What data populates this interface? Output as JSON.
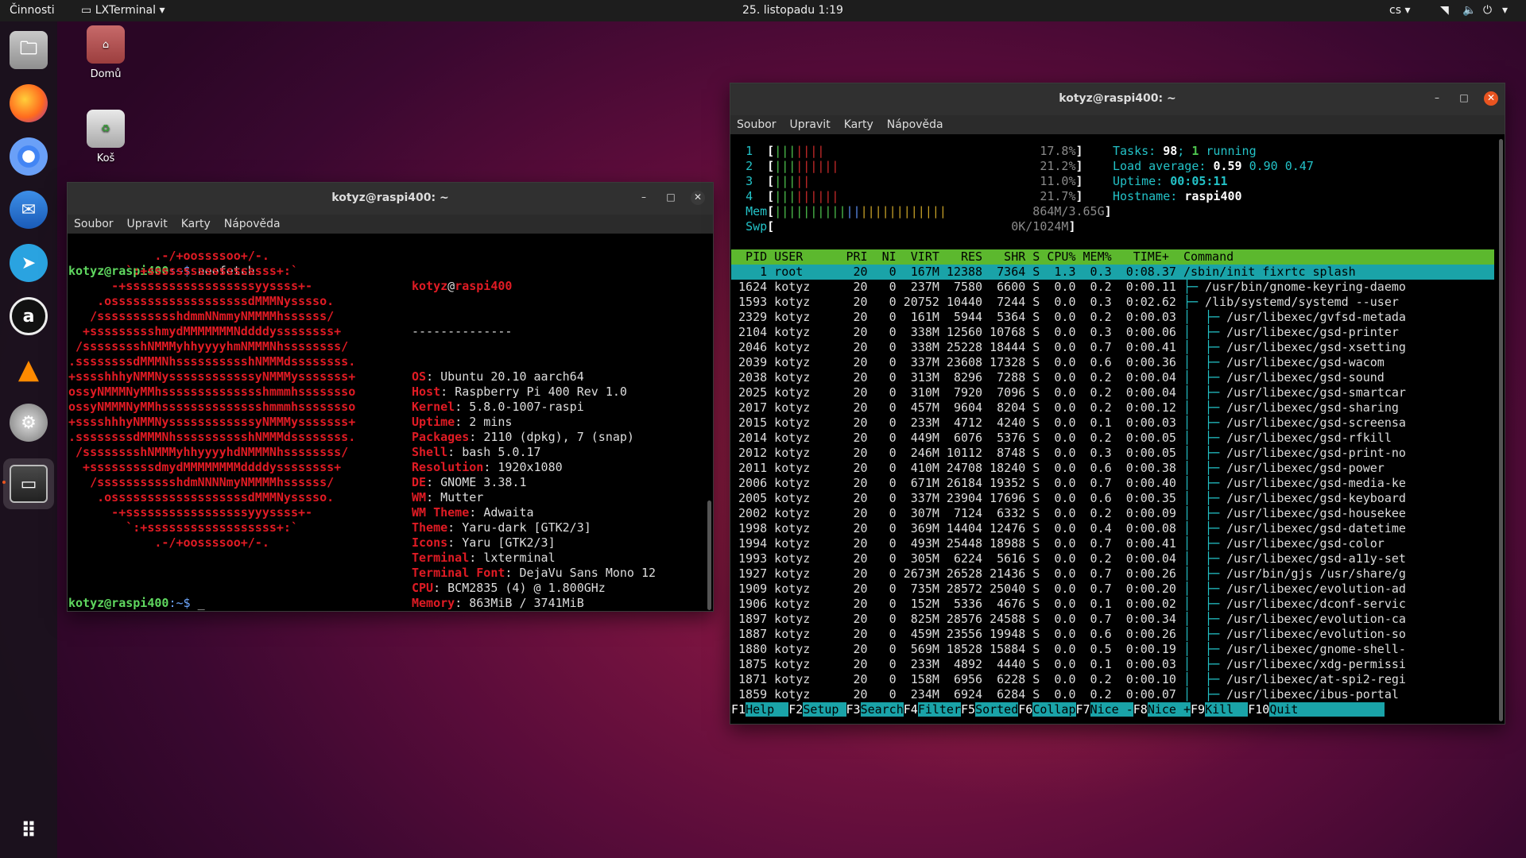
{
  "topbar": {
    "activities": "Činnosti",
    "app": "LXTerminal",
    "clock": "25. listopadu  1:19",
    "lang": "cs"
  },
  "desktop": {
    "home_label": "Domů",
    "trash_label": "Koš"
  },
  "win1": {
    "title": "kotyz@raspi400: ~",
    "menu": [
      "Soubor",
      "Upravit",
      "Karty",
      "Nápověda"
    ],
    "prompt_user": "kotyz@raspi400",
    "prompt_path": ":~$ ",
    "cmd1": "neofetch",
    "cmd2": "_",
    "ascii": [
      "            .-/+oossssoo+/-.",
      "        `:+ssssssssssssssssss+:`",
      "      -+ssssssssssssssssssyyssss+-",
      "    .osssssssssssssssssssdMMMNysssso.",
      "   /ssssssssssshdmmNNmmyNMMMMhssssss/",
      "  +ssssssssshmydMMMMMMMNddddyssssssss+",
      " /sssssssshNMMMyhhyyyyhmNMMMNhssssssss/",
      ".ssssssssdMMMNhsssssssssshNMMMdssssssss.",
      "+sssshhhyNMMNyssssssssssssyNMMMysssssss+",
      "ossyNMMMNyMMhsssssssssssssshmmmhssssssso",
      "ossyNMMMNyMMhsssssssssssssshmmmhssssssso",
      "+sssshhhyNMMNyssssssssssssyNMMMysssssss+",
      ".ssssssssdMMMNhsssssssssshNMMMdssssssss.",
      " /sssssssshNMMMyhhyyyyhdNMMMNhssssssss/",
      "  +sssssssssdmydMMMMMMMMddddyssssssss+",
      "   /ssssssssssshdmNNNNmyNMMMMhssssss/",
      "    .osssssssssssssssssssdMMMNysssso.",
      "      -+sssssssssssssssssyyyssss+-",
      "        `:+ssssssssssssssssss+:`",
      "            .-/+oossssoo+/-."
    ],
    "info_user": "kotyz",
    "info_at": "@",
    "info_host": "raspi400",
    "info_sep": "--------------",
    "info": [
      {
        "k": "OS",
        "v": "Ubuntu 20.10 aarch64"
      },
      {
        "k": "Host",
        "v": "Raspberry Pi 400 Rev 1.0"
      },
      {
        "k": "Kernel",
        "v": "5.8.0-1007-raspi"
      },
      {
        "k": "Uptime",
        "v": "2 mins"
      },
      {
        "k": "Packages",
        "v": "2110 (dpkg), 7 (snap)"
      },
      {
        "k": "Shell",
        "v": "bash 5.0.17"
      },
      {
        "k": "Resolution",
        "v": "1920x1080"
      },
      {
        "k": "DE",
        "v": "GNOME 3.38.1"
      },
      {
        "k": "WM",
        "v": "Mutter"
      },
      {
        "k": "WM Theme",
        "v": "Adwaita"
      },
      {
        "k": "Theme",
        "v": "Yaru-dark [GTK2/3]"
      },
      {
        "k": "Icons",
        "v": "Yaru [GTK2/3]"
      },
      {
        "k": "Terminal",
        "v": "lxterminal"
      },
      {
        "k": "Terminal Font",
        "v": "DejaVu Sans Mono 12"
      },
      {
        "k": "CPU",
        "v": "BCM2835 (4) @ 1.800GHz"
      },
      {
        "k": "Memory",
        "v": "863MiB / 3741MiB"
      }
    ],
    "palette_top": [
      "#000000",
      "#e01b24",
      "#4e9a06",
      "#c4a000",
      "#3465a4",
      "#75507b",
      "#06989a",
      "#d3d7cf"
    ],
    "palette_bot": [
      "#555753",
      "#ff1e1e",
      "#8ae234",
      "#fce94f",
      "#729fcf",
      "#ad7fa8",
      "#34e2e2",
      "#eeeeec"
    ]
  },
  "win2": {
    "title": "kotyz@raspi400: ~",
    "menu": [
      "Soubor",
      "Upravit",
      "Karty",
      "Nápověda"
    ],
    "cpus": [
      {
        "n": "1",
        "g": "|||",
        "r": "||||",
        "pct": "17.8%"
      },
      {
        "n": "2",
        "g": "|||",
        "r": "||||||",
        "pct": "21.2%"
      },
      {
        "n": "3",
        "g": "|||",
        "r": "||",
        "pct": "11.0%"
      },
      {
        "n": "4",
        "g": "|||",
        "r": "||||||",
        "pct": "21.7%"
      }
    ],
    "mem_label": "Mem",
    "mem_value": "864M/3.65G",
    "swp_label": "Swp",
    "swp_value": "0K/1024M",
    "tasks_label": "Tasks: ",
    "tasks": "98",
    "running": "1",
    "running_label": " running",
    "load_label": "Load average: ",
    "load1": "0.59",
    "load5": "0.90",
    "load15": "0.47",
    "uptime_label": "Uptime: ",
    "uptime": "00:05:11",
    "hostname_label": "Hostname: ",
    "hostname": "raspi400",
    "header": "  PID USER      PRI  NI  VIRT   RES   SHR S CPU% MEM%   TIME+  Command",
    "processes": [
      {
        "pid": "1",
        "user": "root",
        "pri": "20",
        "ni": "0",
        "virt": "167M",
        "res": "12388",
        "shr": "7364",
        "s": "S",
        "cpu": "1.3",
        "mem": "0.3",
        "time": "0:08.37",
        "tree": "",
        "cmd": "/sbin/init fixrtc splash"
      },
      {
        "pid": "1624",
        "user": "kotyz",
        "pri": "20",
        "ni": "0",
        "virt": "237M",
        "res": "7580",
        "shr": "6600",
        "s": "S",
        "cpu": "0.0",
        "mem": "0.2",
        "time": "0:00.11",
        "tree": "├─ ",
        "cmd": "/usr/bin/gnome-keyring-daemo"
      },
      {
        "pid": "1593",
        "user": "kotyz",
        "pri": "20",
        "ni": "0",
        "virt": "20752",
        "res": "10440",
        "shr": "7244",
        "s": "S",
        "cpu": "0.0",
        "mem": "0.3",
        "time": "0:02.62",
        "tree": "├─ ",
        "cmd": "/lib/systemd/systemd --user"
      },
      {
        "pid": "2329",
        "user": "kotyz",
        "pri": "20",
        "ni": "0",
        "virt": "161M",
        "res": "5944",
        "shr": "5364",
        "s": "S",
        "cpu": "0.0",
        "mem": "0.2",
        "time": "0:00.03",
        "tree": "│  ├─ ",
        "cmd": "/usr/libexec/gvfsd-metada"
      },
      {
        "pid": "2104",
        "user": "kotyz",
        "pri": "20",
        "ni": "0",
        "virt": "338M",
        "res": "12560",
        "shr": "10768",
        "s": "S",
        "cpu": "0.0",
        "mem": "0.3",
        "time": "0:00.06",
        "tree": "│  ├─ ",
        "cmd": "/usr/libexec/gsd-printer"
      },
      {
        "pid": "2046",
        "user": "kotyz",
        "pri": "20",
        "ni": "0",
        "virt": "338M",
        "res": "25228",
        "shr": "18444",
        "s": "S",
        "cpu": "0.0",
        "mem": "0.7",
        "time": "0:00.41",
        "tree": "│  ├─ ",
        "cmd": "/usr/libexec/gsd-xsetting"
      },
      {
        "pid": "2039",
        "user": "kotyz",
        "pri": "20",
        "ni": "0",
        "virt": "337M",
        "res": "23608",
        "shr": "17328",
        "s": "S",
        "cpu": "0.0",
        "mem": "0.6",
        "time": "0:00.36",
        "tree": "│  ├─ ",
        "cmd": "/usr/libexec/gsd-wacom"
      },
      {
        "pid": "2038",
        "user": "kotyz",
        "pri": "20",
        "ni": "0",
        "virt": "313M",
        "res": "8296",
        "shr": "7288",
        "s": "S",
        "cpu": "0.0",
        "mem": "0.2",
        "time": "0:00.04",
        "tree": "│  ├─ ",
        "cmd": "/usr/libexec/gsd-sound"
      },
      {
        "pid": "2025",
        "user": "kotyz",
        "pri": "20",
        "ni": "0",
        "virt": "310M",
        "res": "7920",
        "shr": "7096",
        "s": "S",
        "cpu": "0.0",
        "mem": "0.2",
        "time": "0:00.04",
        "tree": "│  ├─ ",
        "cmd": "/usr/libexec/gsd-smartcar"
      },
      {
        "pid": "2017",
        "user": "kotyz",
        "pri": "20",
        "ni": "0",
        "virt": "457M",
        "res": "9604",
        "shr": "8204",
        "s": "S",
        "cpu": "0.0",
        "mem": "0.2",
        "time": "0:00.12",
        "tree": "│  ├─ ",
        "cmd": "/usr/libexec/gsd-sharing"
      },
      {
        "pid": "2015",
        "user": "kotyz",
        "pri": "20",
        "ni": "0",
        "virt": "233M",
        "res": "4712",
        "shr": "4240",
        "s": "S",
        "cpu": "0.0",
        "mem": "0.1",
        "time": "0:00.03",
        "tree": "│  ├─ ",
        "cmd": "/usr/libexec/gsd-screensa"
      },
      {
        "pid": "2014",
        "user": "kotyz",
        "pri": "20",
        "ni": "0",
        "virt": "449M",
        "res": "6076",
        "shr": "5376",
        "s": "S",
        "cpu": "0.0",
        "mem": "0.2",
        "time": "0:00.05",
        "tree": "│  ├─ ",
        "cmd": "/usr/libexec/gsd-rfkill"
      },
      {
        "pid": "2012",
        "user": "kotyz",
        "pri": "20",
        "ni": "0",
        "virt": "246M",
        "res": "10112",
        "shr": "8748",
        "s": "S",
        "cpu": "0.0",
        "mem": "0.3",
        "time": "0:00.05",
        "tree": "│  ├─ ",
        "cmd": "/usr/libexec/gsd-print-no"
      },
      {
        "pid": "2011",
        "user": "kotyz",
        "pri": "20",
        "ni": "0",
        "virt": "410M",
        "res": "24708",
        "shr": "18240",
        "s": "S",
        "cpu": "0.0",
        "mem": "0.6",
        "time": "0:00.38",
        "tree": "│  ├─ ",
        "cmd": "/usr/libexec/gsd-power"
      },
      {
        "pid": "2006",
        "user": "kotyz",
        "pri": "20",
        "ni": "0",
        "virt": "671M",
        "res": "26184",
        "shr": "19352",
        "s": "S",
        "cpu": "0.0",
        "mem": "0.7",
        "time": "0:00.40",
        "tree": "│  ├─ ",
        "cmd": "/usr/libexec/gsd-media-ke"
      },
      {
        "pid": "2005",
        "user": "kotyz",
        "pri": "20",
        "ni": "0",
        "virt": "337M",
        "res": "23904",
        "shr": "17696",
        "s": "S",
        "cpu": "0.0",
        "mem": "0.6",
        "time": "0:00.35",
        "tree": "│  ├─ ",
        "cmd": "/usr/libexec/gsd-keyboard"
      },
      {
        "pid": "2002",
        "user": "kotyz",
        "pri": "20",
        "ni": "0",
        "virt": "307M",
        "res": "7124",
        "shr": "6332",
        "s": "S",
        "cpu": "0.0",
        "mem": "0.2",
        "time": "0:00.09",
        "tree": "│  ├─ ",
        "cmd": "/usr/libexec/gsd-housekee"
      },
      {
        "pid": "1998",
        "user": "kotyz",
        "pri": "20",
        "ni": "0",
        "virt": "369M",
        "res": "14404",
        "shr": "12476",
        "s": "S",
        "cpu": "0.0",
        "mem": "0.4",
        "time": "0:00.08",
        "tree": "│  ├─ ",
        "cmd": "/usr/libexec/gsd-datetime"
      },
      {
        "pid": "1994",
        "user": "kotyz",
        "pri": "20",
        "ni": "0",
        "virt": "493M",
        "res": "25448",
        "shr": "18988",
        "s": "S",
        "cpu": "0.0",
        "mem": "0.7",
        "time": "0:00.41",
        "tree": "│  ├─ ",
        "cmd": "/usr/libexec/gsd-color"
      },
      {
        "pid": "1993",
        "user": "kotyz",
        "pri": "20",
        "ni": "0",
        "virt": "305M",
        "res": "6224",
        "shr": "5616",
        "s": "S",
        "cpu": "0.0",
        "mem": "0.2",
        "time": "0:00.04",
        "tree": "│  ├─ ",
        "cmd": "/usr/libexec/gsd-a11y-set"
      },
      {
        "pid": "1927",
        "user": "kotyz",
        "pri": "20",
        "ni": "0",
        "virt": "2673M",
        "res": "26528",
        "shr": "21436",
        "s": "S",
        "cpu": "0.0",
        "mem": "0.7",
        "time": "0:00.26",
        "tree": "│  ├─ ",
        "cmd": "/usr/bin/gjs /usr/share/g"
      },
      {
        "pid": "1909",
        "user": "kotyz",
        "pri": "20",
        "ni": "0",
        "virt": "735M",
        "res": "28572",
        "shr": "25040",
        "s": "S",
        "cpu": "0.0",
        "mem": "0.7",
        "time": "0:00.20",
        "tree": "│  ├─ ",
        "cmd": "/usr/libexec/evolution-ad"
      },
      {
        "pid": "1906",
        "user": "kotyz",
        "pri": "20",
        "ni": "0",
        "virt": "152M",
        "res": "5336",
        "shr": "4676",
        "s": "S",
        "cpu": "0.0",
        "mem": "0.1",
        "time": "0:00.02",
        "tree": "│  ├─ ",
        "cmd": "/usr/libexec/dconf-servic"
      },
      {
        "pid": "1897",
        "user": "kotyz",
        "pri": "20",
        "ni": "0",
        "virt": "825M",
        "res": "28576",
        "shr": "24588",
        "s": "S",
        "cpu": "0.0",
        "mem": "0.7",
        "time": "0:00.34",
        "tree": "│  ├─ ",
        "cmd": "/usr/libexec/evolution-ca"
      },
      {
        "pid": "1887",
        "user": "kotyz",
        "pri": "20",
        "ni": "0",
        "virt": "459M",
        "res": "23556",
        "shr": "19948",
        "s": "S",
        "cpu": "0.0",
        "mem": "0.6",
        "time": "0:00.26",
        "tree": "│  ├─ ",
        "cmd": "/usr/libexec/evolution-so"
      },
      {
        "pid": "1880",
        "user": "kotyz",
        "pri": "20",
        "ni": "0",
        "virt": "569M",
        "res": "18528",
        "shr": "15884",
        "s": "S",
        "cpu": "0.0",
        "mem": "0.5",
        "time": "0:00.19",
        "tree": "│  ├─ ",
        "cmd": "/usr/libexec/gnome-shell-"
      },
      {
        "pid": "1875",
        "user": "kotyz",
        "pri": "20",
        "ni": "0",
        "virt": "233M",
        "res": "4892",
        "shr": "4440",
        "s": "S",
        "cpu": "0.0",
        "mem": "0.1",
        "time": "0:00.03",
        "tree": "│  ├─ ",
        "cmd": "/usr/libexec/xdg-permissi"
      },
      {
        "pid": "1871",
        "user": "kotyz",
        "pri": "20",
        "ni": "0",
        "virt": "158M",
        "res": "6956",
        "shr": "6228",
        "s": "S",
        "cpu": "0.0",
        "mem": "0.2",
        "time": "0:00.10",
        "tree": "│  ├─ ",
        "cmd": "/usr/libexec/at-spi2-regi"
      },
      {
        "pid": "1859",
        "user": "kotyz",
        "pri": "20",
        "ni": "0",
        "virt": "234M",
        "res": "6924",
        "shr": "6284",
        "s": "S",
        "cpu": "0.0",
        "mem": "0.2",
        "time": "0:00.07",
        "tree": "│  ├─ ",
        "cmd": "/usr/libexec/ibus-portal"
      }
    ],
    "fkeys": [
      {
        "k": "F1",
        "l": "Help  "
      },
      {
        "k": "F2",
        "l": "Setup "
      },
      {
        "k": "F3",
        "l": "Search"
      },
      {
        "k": "F4",
        "l": "Filter"
      },
      {
        "k": "F5",
        "l": "Sorted"
      },
      {
        "k": "F6",
        "l": "Collap"
      },
      {
        "k": "F7",
        "l": "Nice -"
      },
      {
        "k": "F8",
        "l": "Nice +"
      },
      {
        "k": "F9",
        "l": "Kill  "
      },
      {
        "k": "F10",
        "l": "Quit"
      }
    ]
  }
}
